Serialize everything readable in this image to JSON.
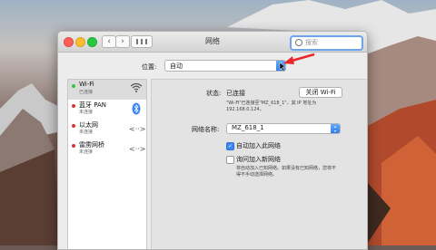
{
  "window": {
    "title": "网络"
  },
  "search": {
    "placeholder": "搜索"
  },
  "location": {
    "label": "位置:",
    "value": "自动"
  },
  "sidebar": {
    "items": [
      {
        "name": "Wi-Fi",
        "status": "已连接",
        "status_color": "#3cc23f",
        "icon": "wifi-icon",
        "selected": true
      },
      {
        "name": "蓝牙 PAN",
        "status": "未连接",
        "status_color": "#e0312f",
        "icon": "bluetooth-icon",
        "selected": false
      },
      {
        "name": "以太网",
        "status": "未连接",
        "status_color": "#e0312f",
        "icon": "ethernet-icon",
        "selected": false
      },
      {
        "name": "雷雳网桥",
        "status": "未连接",
        "status_color": "#e0312f",
        "icon": "thunderbolt-bridge-icon",
        "selected": false
      }
    ]
  },
  "detail": {
    "status_label": "状态:",
    "status_value": "已连接",
    "turn_off_button": "关闭 Wi-Fi",
    "status_desc_1": "\"Wi-Fi\"已连接至\"MZ_618_1\"，其 IP 地址为",
    "status_desc_2": "192.168.0.124。",
    "network_name_label": "网络名称:",
    "network_name_value": "MZ_618_1",
    "auto_join_label": "自动加入此网络",
    "auto_join_checked": true,
    "ask_join_label": "询问加入新网络",
    "ask_join_checked": false,
    "ask_desc_1": "将自动加入已知网络。如果没有已知网络，您将不",
    "ask_desc_2": "得不手动选择网络。"
  },
  "colors": {
    "accent": "#3a86f2",
    "annotation_arrow": "#e8262b"
  }
}
